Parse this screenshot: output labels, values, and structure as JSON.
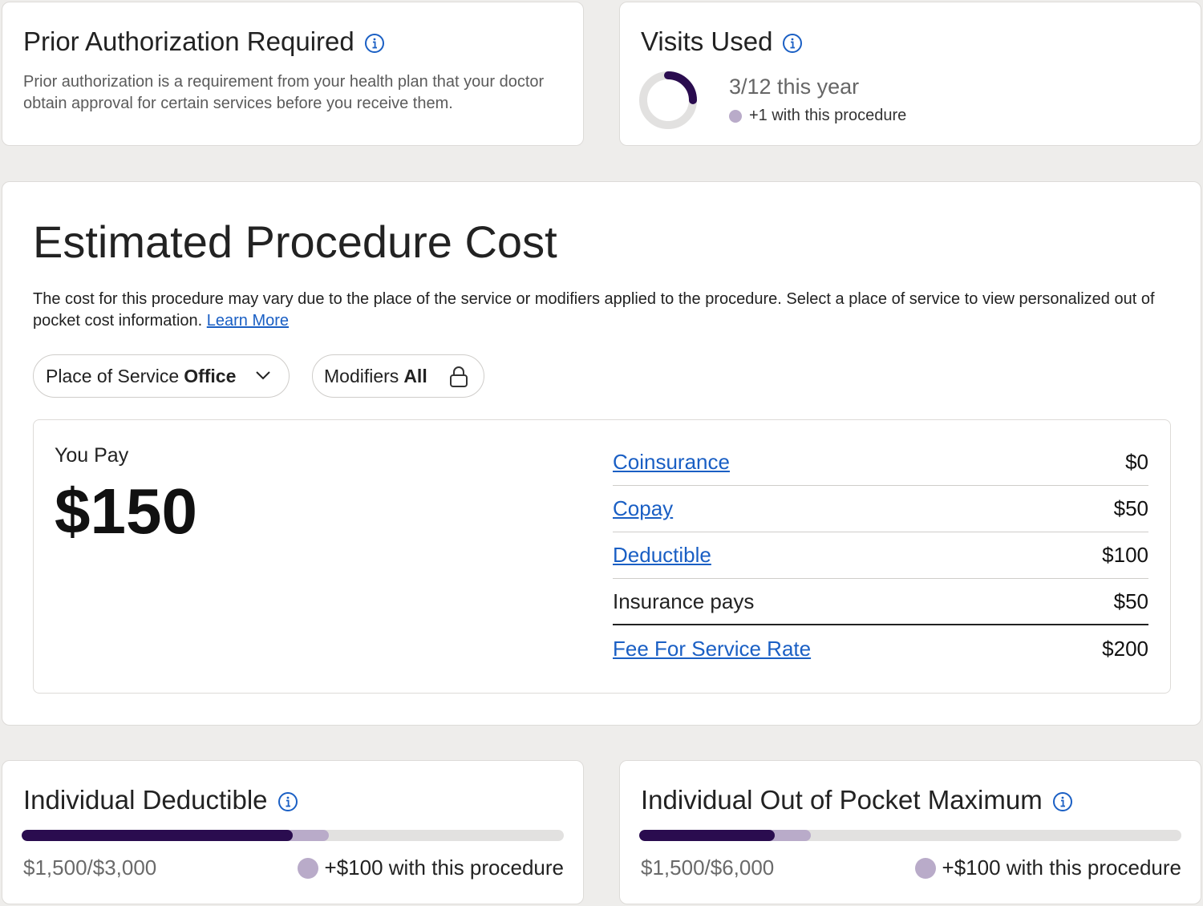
{
  "colors": {
    "accent": "#1a5fc4",
    "progress_used": "#2a0c4f",
    "progress_added": "#b9abc9",
    "track": "#e2e1e0"
  },
  "prior_auth": {
    "title": "Prior Authorization Required",
    "icon": "info-icon",
    "description": "Prior authorization is a requirement from your health plan that your doctor obtain approval for certain services before you receive them."
  },
  "visits": {
    "title": "Visits Used",
    "icon": "info-icon",
    "used": 3,
    "total": 12,
    "count_text": "3/12 this year",
    "note": "+1 with this procedure"
  },
  "estimate": {
    "title": "Estimated Procedure Cost",
    "description": "The cost for this procedure may vary due to the place of the service or modifiers applied to the procedure. Select a place of service to view personalized out of pocket cost information.",
    "learn_more": "Learn More",
    "place_label": "Place of Service",
    "place_value": "Office",
    "modifiers_label": "Modifiers",
    "modifiers_value": "All",
    "you_pay_label": "You Pay",
    "you_pay_amount": "$150",
    "breakdown": [
      {
        "label": "Coinsurance",
        "value": "$0",
        "link": true
      },
      {
        "label": "Copay",
        "value": "$50",
        "link": true
      },
      {
        "label": "Deductible",
        "value": "$100",
        "link": true
      },
      {
        "label": "Insurance pays",
        "value": "$50",
        "link": false
      },
      {
        "label": "Fee For Service Rate",
        "value": "$200",
        "link": true
      }
    ]
  },
  "deductible": {
    "title": "Individual Deductible",
    "icon": "info-icon",
    "amount_text": "$1,500/$3,000",
    "used": 1500,
    "max": 3000,
    "added": 100,
    "note": "+$100 with this procedure"
  },
  "oop": {
    "title": "Individual Out of Pocket Maximum",
    "icon": "info-icon",
    "amount_text": "$1,500/$6,000",
    "used": 1500,
    "max": 6000,
    "added": 100,
    "note": "+$100 with this procedure"
  }
}
